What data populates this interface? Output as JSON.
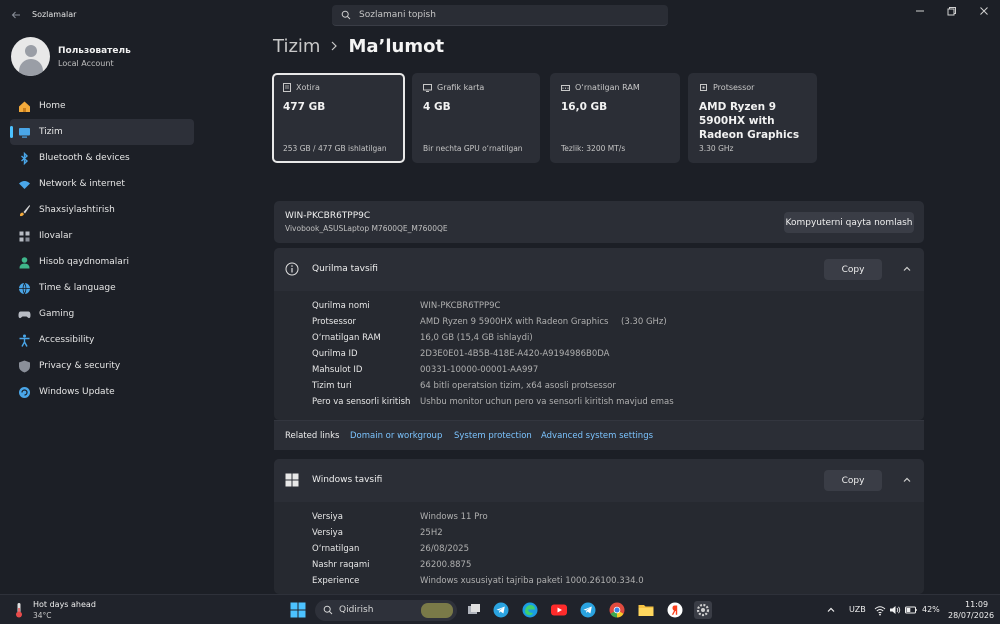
{
  "window": {
    "app_title": "Sozlamalar",
    "search_placeholder": "Sozlamani topish"
  },
  "profile": {
    "name": "Пользователь",
    "account_type": "Local Account"
  },
  "sidebar": {
    "items": [
      {
        "label": "Home",
        "icon": "home-icon"
      },
      {
        "label": "Tizim",
        "icon": "system-icon",
        "active": true
      },
      {
        "label": "Bluetooth & devices",
        "icon": "bluetooth-icon"
      },
      {
        "label": "Network & internet",
        "icon": "wifi-icon"
      },
      {
        "label": "Shaxsiylashtirish",
        "icon": "brush-icon"
      },
      {
        "label": "Ilovalar",
        "icon": "apps-icon"
      },
      {
        "label": "Hisob qaydnomalari",
        "icon": "person-icon"
      },
      {
        "label": "Time & language",
        "icon": "globe-icon"
      },
      {
        "label": "Gaming",
        "icon": "gamepad-icon"
      },
      {
        "label": "Accessibility",
        "icon": "accessibility-icon"
      },
      {
        "label": "Privacy & security",
        "icon": "shield-icon"
      },
      {
        "label": "Windows Update",
        "icon": "update-icon"
      }
    ]
  },
  "breadcrumb": {
    "parent": "Tizim",
    "current": "Ma’lumot"
  },
  "cards": [
    {
      "title": "Xotira",
      "value": "477 GB",
      "sub": "253 GB / 477 GB ishlatilgan",
      "icon": "storage-icon"
    },
    {
      "title": "Grafik karta",
      "value": "4 GB",
      "sub": "Bir nechta GPU o‘rnatilgan",
      "icon": "gpu-icon"
    },
    {
      "title": "O‘rnatilgan RAM",
      "value": "16,0 GB",
      "sub": "Tezlik: 3200 MT/s",
      "icon": "ram-icon"
    },
    {
      "title": "Protsessor",
      "value": "AMD Ryzen 9 5900HX with Radeon Graphics",
      "sub": "3.30 GHz",
      "icon": "cpu-icon"
    }
  ],
  "device": {
    "name": "WIN-PKCBR6TPP9C",
    "model": "Vivobook_ASUSLaptop M7600QE_M7600QE",
    "rename_label": "Kompyuterni qayta nomlash"
  },
  "device_spec": {
    "title": "Qurilma tavsifi",
    "copy_label": "Copy",
    "rows": [
      {
        "label": "Qurilma nomi",
        "value": "WIN-PKCBR6TPP9C",
        "extra": ""
      },
      {
        "label": "Protsessor",
        "value": "AMD Ryzen 9 5900HX with Radeon Graphics",
        "extra": "(3.30 GHz)"
      },
      {
        "label": "O‘rnatilgan RAM",
        "value": "16,0 GB (15,4 GB ishlaydi)",
        "extra": ""
      },
      {
        "label": "Qurilma ID",
        "value": "2D3E0E01-4B5B-418E-A420-A9194986B0DA",
        "extra": ""
      },
      {
        "label": "Mahsulot ID",
        "value": "00331-10000-00001-AA997",
        "extra": ""
      },
      {
        "label": "Tizim turi",
        "value": "64 bitli operatsion tizim, x64 asosli protsessor",
        "extra": ""
      },
      {
        "label": "Pero va sensorli kiritish",
        "value": "Ushbu monitor uchun pero va sensorli kiritish mavjud emas",
        "extra": ""
      }
    ]
  },
  "related": {
    "label": "Related links",
    "links": [
      "Domain or workgroup",
      "System protection",
      "Advanced system settings"
    ]
  },
  "windows_spec": {
    "title": "Windows tavsifi",
    "copy_label": "Copy",
    "rows": [
      {
        "label": "Versiya",
        "value": "Windows 11 Pro"
      },
      {
        "label": "Versiya",
        "value": "25H2"
      },
      {
        "label": "O‘rnatilgan",
        "value": "26/08/2025"
      },
      {
        "label": "Nashr raqami",
        "value": "26200.8875"
      },
      {
        "label": "Experience",
        "value": "Windows xususiyati tajriba paketi 1000.26100.334.0"
      }
    ]
  },
  "taskbar": {
    "weather_title": "Hot days ahead",
    "weather_temp": "34°C",
    "search_text": "Qidirish",
    "lang": "UZB",
    "battery": "42%",
    "time": "11:09",
    "date": "28/07/2026"
  },
  "colors": {
    "accent": "#4cc2ff",
    "link": "#7cc4ff",
    "background": "#1c1f26"
  }
}
